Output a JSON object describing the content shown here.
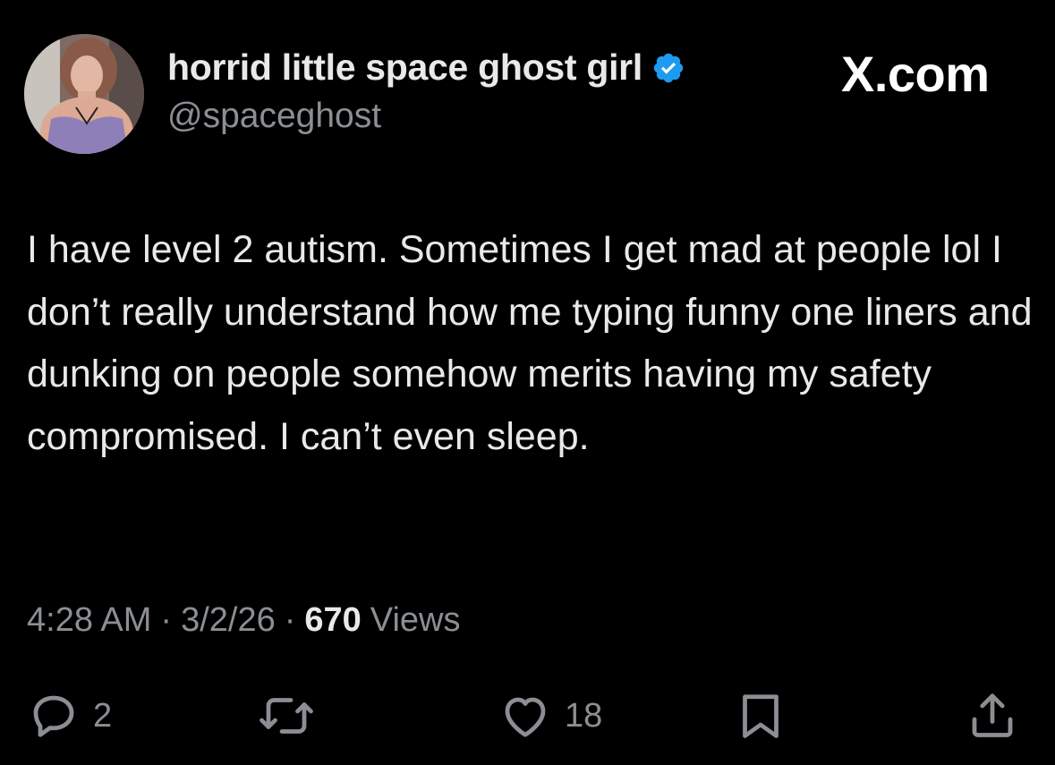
{
  "author": {
    "display_name": "horrid little space ghost girl",
    "handle": "@spaceghost",
    "verified": true,
    "verified_color": "#1d9bf0"
  },
  "brand": {
    "label": "X.com"
  },
  "post": {
    "text": "I have level 2 autism. Sometimes I get mad at people lol I don’t really understand how me typing funny one liners and dunking on people somehow merits having my safety compromised. I can’t even sleep."
  },
  "meta": {
    "time": "4:28 AM",
    "separator": "·",
    "date": "3/2/26",
    "views_count": "670",
    "views_label": "Views"
  },
  "actions": {
    "reply": {
      "icon": "reply-icon",
      "count": "2"
    },
    "repost": {
      "icon": "repost-icon",
      "count": ""
    },
    "like": {
      "icon": "heart-icon",
      "count": "18"
    },
    "bookmark": {
      "icon": "bookmark-icon"
    },
    "share": {
      "icon": "share-icon"
    }
  },
  "colors": {
    "background": "#000000",
    "text_primary": "#e7e9ea",
    "text_secondary": "#8b8f94"
  }
}
